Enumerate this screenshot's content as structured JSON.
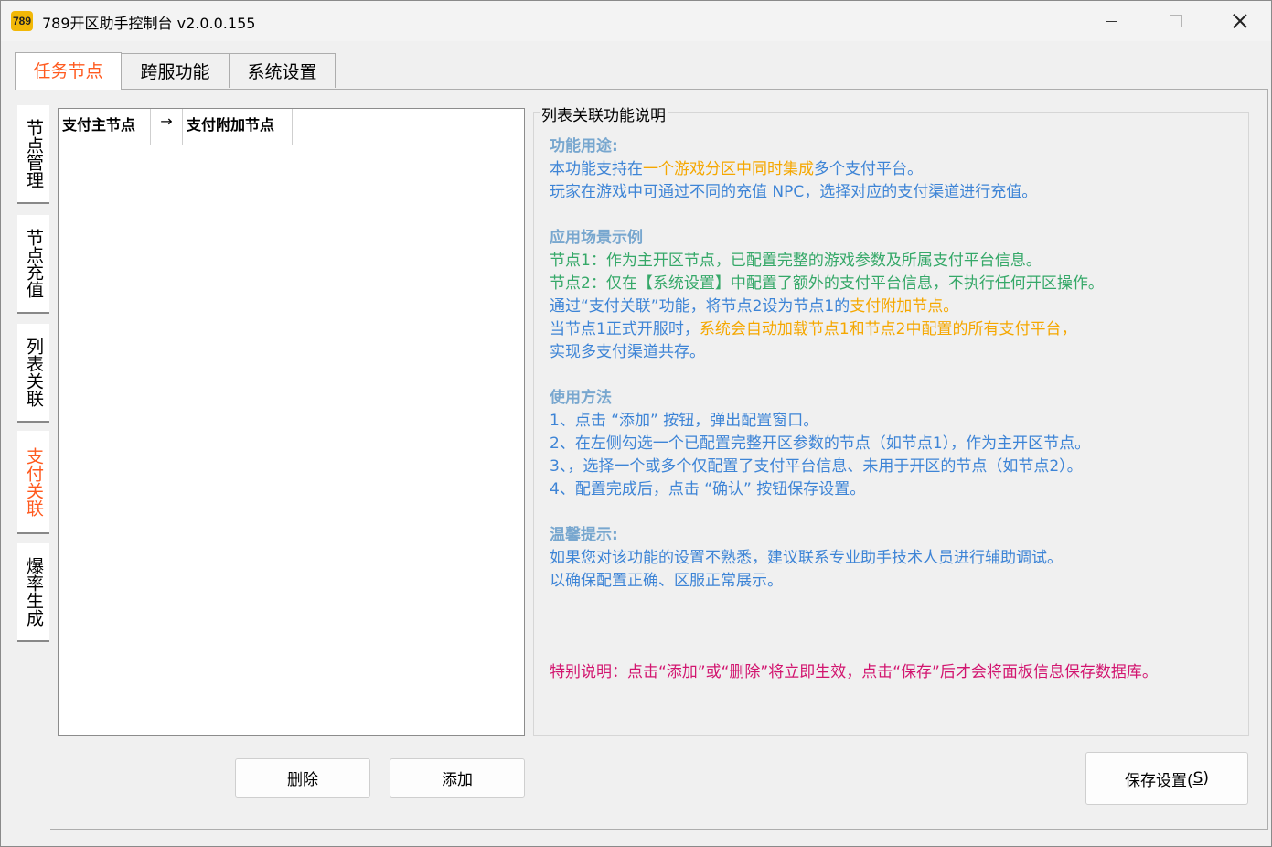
{
  "window": {
    "icon_text": "789",
    "title": "789开区助手控制台 v2.0.0.155"
  },
  "top_tabs": [
    {
      "label": "任务节点",
      "active": true
    },
    {
      "label": "跨服功能",
      "active": false
    },
    {
      "label": "系统设置",
      "active": false
    }
  ],
  "side_tabs": [
    {
      "label": "节点管理",
      "active": false
    },
    {
      "label": "节点充值",
      "active": false
    },
    {
      "label": "列表关联",
      "active": false
    },
    {
      "label": "支付关联",
      "active": true
    },
    {
      "label": "爆率生成",
      "active": false
    }
  ],
  "list": {
    "columns": [
      "支付主节点",
      "→",
      "支付附加节点"
    ],
    "rows": []
  },
  "info": {
    "legend": "列表关联功能说明",
    "purpose_heading": "功能用途:",
    "purpose_l1_a": "本功能支持在",
    "purpose_l1_b": "一个游戏分区中同时集成",
    "purpose_l1_c": "多个支付平台。",
    "purpose_l2": "玩家在游戏中可通过不同的充值 NPC，选择对应的支付渠道进行充值。",
    "scene_heading": "应用场景示例",
    "scene_l1": "节点1：作为主开区节点，已配置完整的游戏参数及所属支付平台信息。",
    "scene_l2": "节点2：仅在【系统设置】中配置了额外的支付平台信息，不执行任何开区操作。",
    "scene_l3_a": "通过“支付关联”功能，将节点2设为节点1的",
    "scene_l3_b": "支付附加节点。",
    "scene_l4_a": "当节点1正式开服时，",
    "scene_l4_b": "系统会自动加载节点1和节点2中配置的所有支付平台，",
    "scene_l5": "实现多支付渠道共存。",
    "usage_heading": "使用方法",
    "usage_l1": "1、点击 “添加” 按钮，弹出配置窗口。",
    "usage_l2": "2、在左侧勾选一个已配置完整开区参数的节点（如节点1），作为主开区节点。",
    "usage_l3": "3、，选择一个或多个仅配置了支付平台信息、未用于开区的节点（如节点2）。",
    "usage_l4": "4、配置完成后，点击 “确认” 按钮保存设置。",
    "tip_heading": "温馨提示:",
    "tip_l1": "如果您对该功能的设置不熟悉，建议联系专业助手技术人员进行辅助调试。",
    "tip_l2": "以确保配置正确、区服正常展示。",
    "special_a": "特别说明：点击“添加”或“删除”将立即生效，",
    "special_b": "点击“保存”后才会将面板信息保存数据库。"
  },
  "buttons": {
    "delete": "删除",
    "add": "添加",
    "save_main": "保存设置(",
    "save_key": "S",
    "save_end": ")"
  },
  "colors": {
    "accent": "#ff5a1f",
    "info_blue": "#3d84d6",
    "info_green": "#35a868",
    "info_orange": "#f5a700",
    "heading": "#78a7cf",
    "special": "#d2156f"
  }
}
